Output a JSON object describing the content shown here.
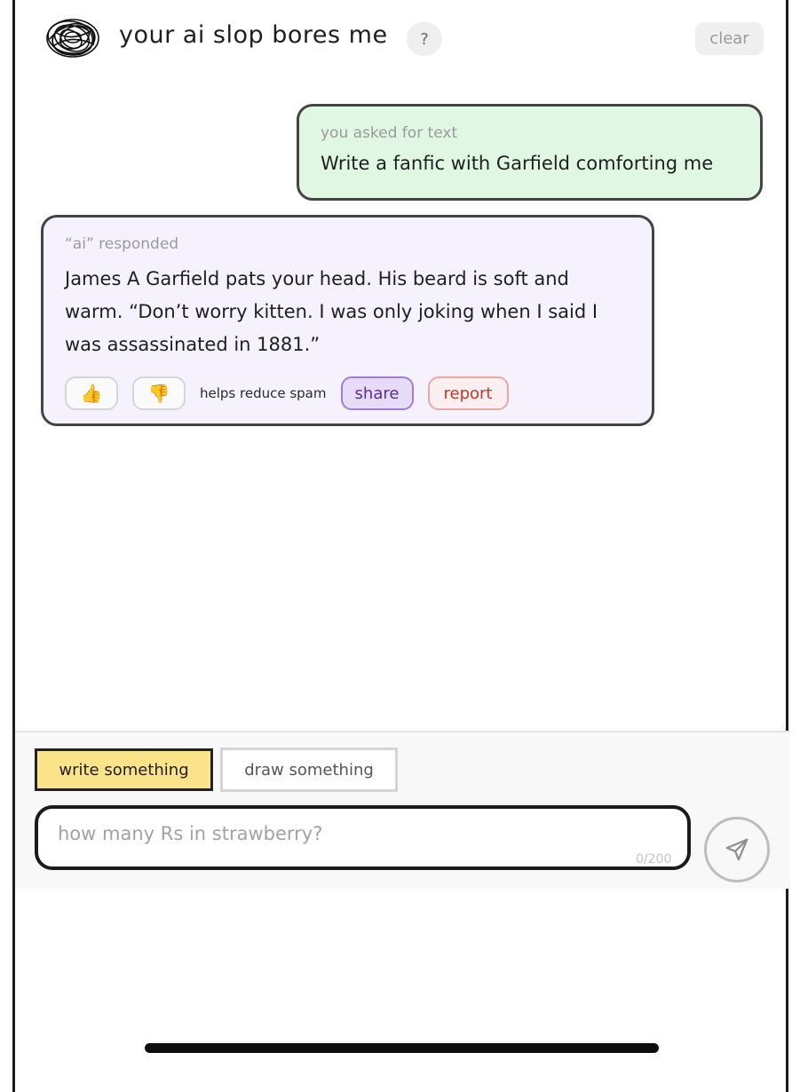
{
  "header": {
    "title": "your ai slop bores me",
    "help_label": "?",
    "clear_label": "clear",
    "logo_icon": "scribble-logo-icon"
  },
  "messages": [
    {
      "role": "user",
      "meta": "you asked for text",
      "text": "Write a fanfic with Garfield comforting me",
      "bg_color": "#e0f7e4"
    },
    {
      "role": "ai",
      "meta": "“ai” responded",
      "text": "James A Garfield pats your head. His beard is soft and warm. “Don’t worry kitten. I was only joking when I said I was assassinated in 1881.”",
      "bg_color": "#f6f2fd",
      "actions": {
        "thumbs_up": "👍",
        "thumbs_down": "👎",
        "spam_note": "helps reduce spam",
        "share_label": "share",
        "report_label": "report"
      }
    }
  ],
  "composer": {
    "modes": [
      {
        "label": "write something",
        "active": true,
        "color": "#fbe38a"
      },
      {
        "label": "draw something",
        "active": false
      }
    ],
    "input_value": "",
    "input_placeholder": "how many Rs in strawberry?",
    "char_count": "0/200",
    "send_icon": "send-arrow-icon"
  }
}
